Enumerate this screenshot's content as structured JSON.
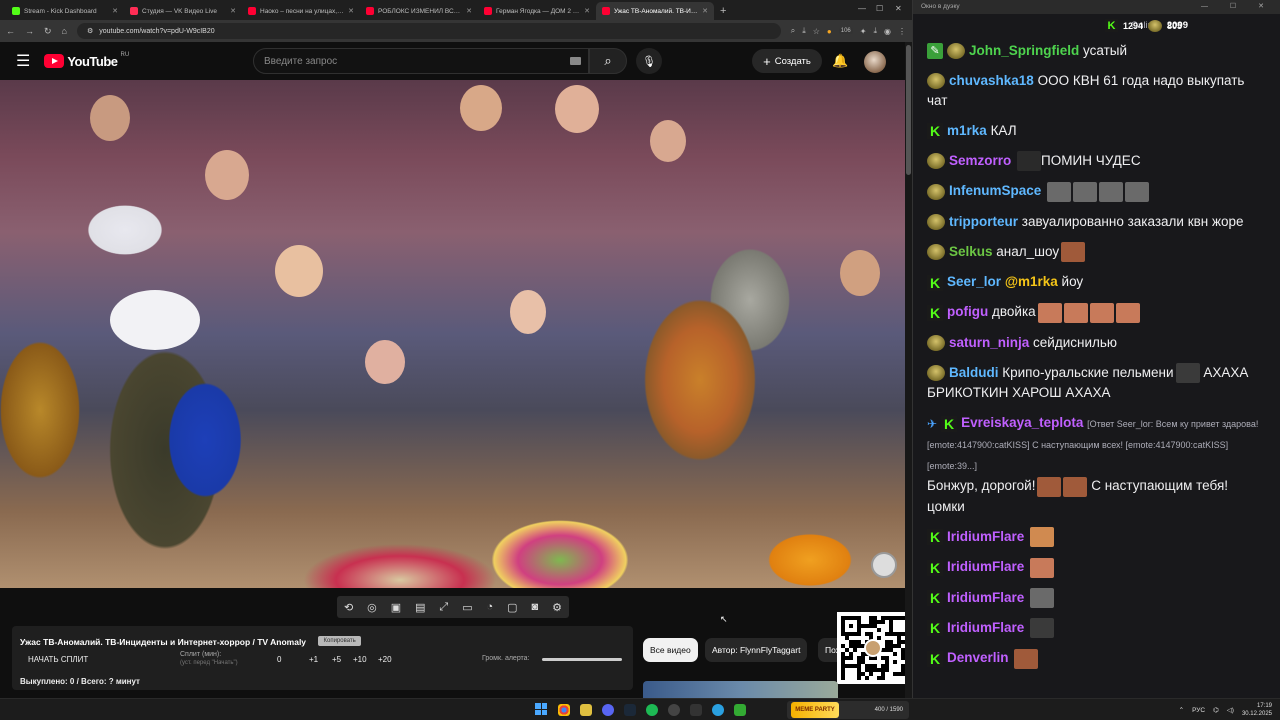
{
  "browser": {
    "tabs": [
      {
        "title": "Stream - Kick Dashboard",
        "color": "#53fc18",
        "active": false
      },
      {
        "title": "Студия — VK Видео Live",
        "color": "#ff2d55",
        "active": false
      },
      {
        "title": "Наоко – песни на улицах, арт",
        "color": "#ff0033",
        "active": false
      },
      {
        "title": "РОБЛОКС ИЗМЕНИЛ ВСЮ МОЮ",
        "color": "#ff0033",
        "active": false
      },
      {
        "title": "Герман Ягодка — ДОМ 2 и все",
        "color": "#ff0033",
        "active": false
      },
      {
        "title": "Ужас ТВ-Аномалий. ТВ-Ин...",
        "color": "#ff0033",
        "active": true
      }
    ],
    "url": "youtube.com/watch?v=pdU-W9cIB20",
    "ext_badge": "106"
  },
  "youtube": {
    "logo": "YouTube",
    "region": "RU",
    "search_placeholder": "Введите запрос",
    "create_label": "Создать"
  },
  "panel": {
    "title": "Ужас ТВ-Аномалий. ТВ-Инциденты и Интернет-хоррор / TV Anomaly",
    "copy_label": "Копировать",
    "start_split": "НАЧАТЬ СПЛИТ",
    "split_label": "Сплит (мин):",
    "split_hint": "(уст. перед \"Начать\")",
    "split_value": "0",
    "increments": [
      "+1",
      "+5",
      "+10",
      "+20"
    ],
    "alert_label": "Громк. алерта:",
    "bought": "Выкуплено: 0 / Всего: ? минут",
    "alert_volume": 1.0
  },
  "chips": {
    "all": "Все видео",
    "author": "Автор: FlynnFlyTaggart",
    "more": "Пох"
  },
  "chat": {
    "window_title": "Окно в дуэку",
    "online_label": "Online:",
    "online_count": "2099",
    "kick_count": "1294",
    "sub_count": "805",
    "messages": [
      {
        "badges": [
          "pen",
          "sub"
        ],
        "user": "John_Springfield",
        "color": "#4ed34e",
        "text": "усатый",
        "emotes": 0
      },
      {
        "badges": [
          "sub"
        ],
        "user": "chuvashka18",
        "color": "#5fb8ff",
        "text": "ООО КВН 61 года надо выкупать чат",
        "emotes": 0
      },
      {
        "badges": [
          "kick"
        ],
        "user": "m1rka",
        "color": "#5fb8ff",
        "text": "КАЛ",
        "emotes": 0
      },
      {
        "badges": [
          "sub"
        ],
        "user": "Semzorro",
        "color": "#c060ff",
        "text": "ПОМИН ЧУДЕС",
        "emotes": 1,
        "emote_first": true
      },
      {
        "badges": [
          "sub"
        ],
        "user": "InfenumSpace",
        "color": "#5fb8ff",
        "text": "",
        "emotes": 4
      },
      {
        "badges": [
          "sub"
        ],
        "user": "tripporteur",
        "color": "#5fb8ff",
        "text": "завуалированно заказали квн жоре",
        "emotes": 0
      },
      {
        "badges": [
          "sub"
        ],
        "user": "Selkus",
        "color": "#6cc644",
        "text": "анал_шоу",
        "emotes": 1
      },
      {
        "badges": [
          "kick"
        ],
        "user": "Seer_lor",
        "color": "#5fb8ff",
        "text": "йоу",
        "mention": "@m1rka",
        "emotes": 0
      },
      {
        "badges": [
          "kick"
        ],
        "user": "pofigu",
        "color": "#c060ff",
        "text": "двойка",
        "emotes": 4
      },
      {
        "badges": [
          "sub"
        ],
        "user": "saturn_ninja",
        "color": "#c060ff",
        "text": "сейдиснилью",
        "emotes": 0
      },
      {
        "badges": [
          "sub"
        ],
        "user": "Baldudi",
        "color": "#5fb8ff",
        "text": "Крипо-уральские пельмени",
        "text2": "АХАХА БРИКОТКИН ХАРОШ АХАХА",
        "emotes": 1
      },
      {
        "badges": [
          "wrench",
          "kick"
        ],
        "user": "Evreiskaya_teplota",
        "color": "#c060ff",
        "reply": "[Ответ Seer_lor: Всем ку привет здарова! [emote:4147900:catKISS] С наступающим всех! [emote:4147900:catKISS][emote:39...]",
        "text": "Бонжур, дорогой!",
        "text2": "С наступающим тебя! цомки",
        "emotes": 2
      },
      {
        "badges": [
          "kick"
        ],
        "user": "IridiumFlare",
        "color": "#c060ff",
        "text": "",
        "emotes": 1
      },
      {
        "badges": [
          "kick"
        ],
        "user": "IridiumFlare",
        "color": "#c060ff",
        "text": "",
        "emotes": 1
      },
      {
        "badges": [
          "kick"
        ],
        "user": "IridiumFlare",
        "color": "#c060ff",
        "text": "",
        "emotes": 1
      },
      {
        "badges": [
          "kick"
        ],
        "user": "IridiumFlare",
        "color": "#c060ff",
        "text": "",
        "emotes": 1
      },
      {
        "badges": [
          "kick"
        ],
        "user": "Denverlin",
        "color": "#c060ff",
        "text": "",
        "emotes": 1
      }
    ]
  },
  "taskbar": {
    "media_label": "MEME PARTY",
    "media_progress": "400 / 1590",
    "lang": "РУС",
    "time": "17:19",
    "date": "30.12.2025"
  }
}
